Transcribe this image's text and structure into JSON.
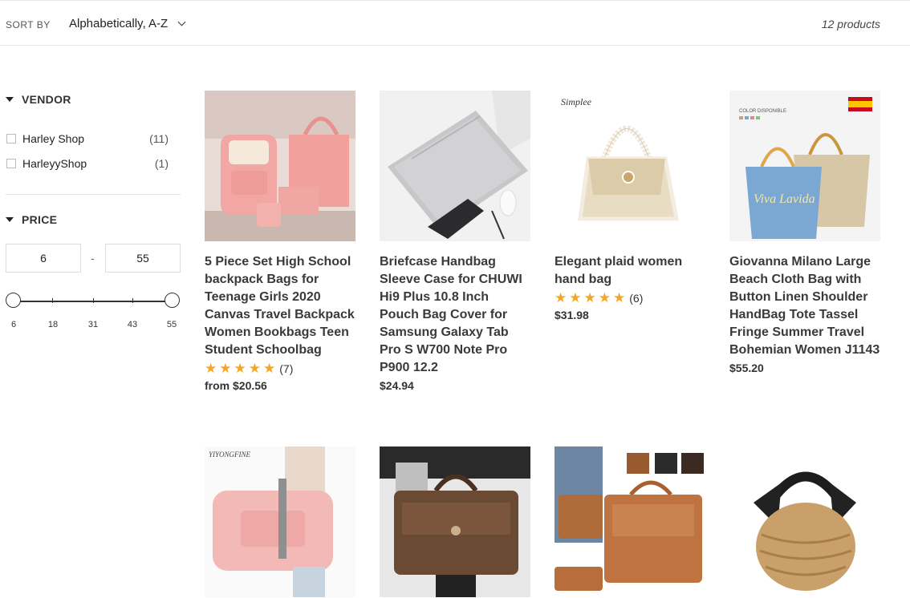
{
  "toolbar": {
    "sort_label": "SORT BY",
    "sort_value": "Alphabetically, A-Z",
    "product_count": "12 products"
  },
  "filters": {
    "vendor_title": "VENDOR",
    "vendors": [
      {
        "name": "Harley Shop",
        "count": "(11)"
      },
      {
        "name": "HarleyyShop",
        "count": "(1)"
      }
    ],
    "price_title": "PRICE",
    "price_min": "6",
    "price_max": "55",
    "price_separator": "-",
    "slider_ticks": [
      "6",
      "18",
      "31",
      "43",
      "55"
    ]
  },
  "products": [
    {
      "title": "5 Piece Set High School backpack Bags for Teenage Girls 2020 Canvas Travel Backpack Women Bookbags Teen Student Schoolbag",
      "rating_count": "(7)",
      "price": "from $20.56",
      "image": "pink-backpack-set"
    },
    {
      "title": "Briefcase Handbag Sleeve Case for CHUWI Hi9 Plus 10.8 Inch Pouch Bag Cover for Samsung Galaxy Tab Pro S W700 Note Pro P900 12.2",
      "rating_count": "",
      "price": "$24.94",
      "image": "grey-laptop-sleeve"
    },
    {
      "title": "Elegant plaid women hand bag",
      "rating_count": "(6)",
      "price": "$31.98",
      "image": "pearl-handle-plaid-bag",
      "image_text": "Simplee"
    },
    {
      "title": "Giovanna Milano Large Beach Cloth Bag with Button Linen Shoulder HandBag Tote Tassel Fringe Summer Travel Bohemian Women J1143",
      "rating_count": "",
      "price": "$55.20",
      "image": "linen-beach-tote",
      "image_text": "COLOR DISPONIBLE"
    },
    {
      "title": "",
      "rating_count": "",
      "price": "",
      "image": "pink-duffel-bag",
      "image_text": "YIYONGFINE"
    },
    {
      "title": "",
      "rating_count": "",
      "price": "",
      "image": "brown-leather-briefcase"
    },
    {
      "title": "",
      "rating_count": "",
      "price": "",
      "image": "tan-leather-briefcase-set"
    },
    {
      "title": "",
      "rating_count": "",
      "price": "",
      "image": "rattan-basket-bag"
    }
  ],
  "colors": {
    "star": "#f5a623",
    "text": "#3a3a3a"
  }
}
